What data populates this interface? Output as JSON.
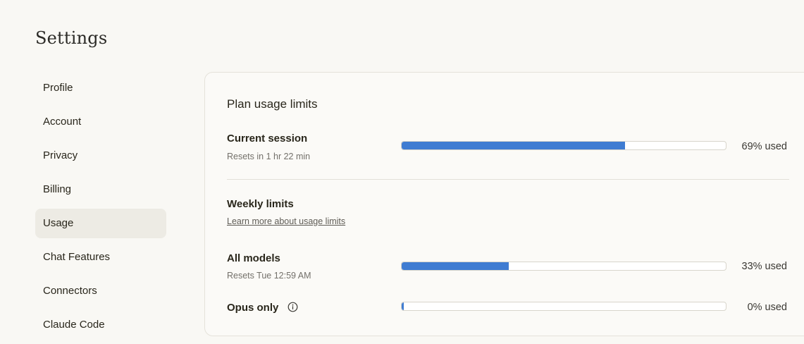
{
  "page": {
    "title": "Settings"
  },
  "sidebar": {
    "items": [
      {
        "label": "Profile",
        "active": false
      },
      {
        "label": "Account",
        "active": false
      },
      {
        "label": "Privacy",
        "active": false
      },
      {
        "label": "Billing",
        "active": false
      },
      {
        "label": "Usage",
        "active": true
      },
      {
        "label": "Chat Features",
        "active": false
      },
      {
        "label": "Connectors",
        "active": false
      },
      {
        "label": "Claude Code",
        "active": false
      }
    ]
  },
  "usage": {
    "title": "Plan usage limits",
    "current_session": {
      "label": "Current session",
      "reset": "Resets in 1 hr 22 min",
      "percent": 69,
      "percent_text": "69% used"
    },
    "weekly": {
      "title": "Weekly limits",
      "link": "Learn more about usage limits"
    },
    "all_models": {
      "label": "All models",
      "reset": "Resets Tue 12:59 AM",
      "percent": 33,
      "percent_text": "33% used"
    },
    "opus_only": {
      "label": "Opus only",
      "icon": "info-icon",
      "percent": 0,
      "percent_text": "0% used"
    }
  },
  "colors": {
    "bar_fill": "#3f7cd2",
    "active_nav_bg": "#edebe4",
    "background": "#f9f8f4"
  }
}
